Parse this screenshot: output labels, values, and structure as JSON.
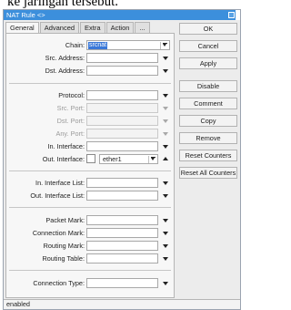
{
  "background": {
    "text": "ke jaringan tersebut."
  },
  "window": {
    "title": "NAT Rule <>"
  },
  "tabs": [
    "General",
    "Advanced",
    "Extra",
    "Action",
    "..."
  ],
  "form": {
    "chain": {
      "label": "Chain:",
      "value": "srcnat"
    },
    "src_address": {
      "label": "Src. Address:"
    },
    "dst_address": {
      "label": "Dst. Address:"
    },
    "protocol": {
      "label": "Protocol:"
    },
    "src_port": {
      "label": "Src. Port:"
    },
    "dst_port": {
      "label": "Dst. Port:"
    },
    "any_port": {
      "label": "Any. Port:"
    },
    "in_interface": {
      "label": "In. Interface:"
    },
    "out_interface": {
      "label": "Out. Interface:",
      "value": "ether1"
    },
    "in_interface_list": {
      "label": "In. Interface List:"
    },
    "out_interface_list": {
      "label": "Out. Interface List:"
    },
    "packet_mark": {
      "label": "Packet Mark:"
    },
    "connection_mark": {
      "label": "Connection Mark:"
    },
    "routing_mark": {
      "label": "Routing Mark:"
    },
    "routing_table": {
      "label": "Routing Table:"
    },
    "connection_type": {
      "label": "Connection Type:"
    }
  },
  "buttons": {
    "ok": "OK",
    "cancel": "Cancel",
    "apply": "Apply",
    "disable": "Disable",
    "comment": "Comment",
    "copy": "Copy",
    "remove": "Remove",
    "reset_counters": "Reset Counters",
    "reset_all_counters": "Reset All Counters"
  },
  "status": {
    "text": "enabled"
  },
  "colors": {
    "titlebar": "#3c8fdc",
    "selection": "#3a78d8"
  }
}
